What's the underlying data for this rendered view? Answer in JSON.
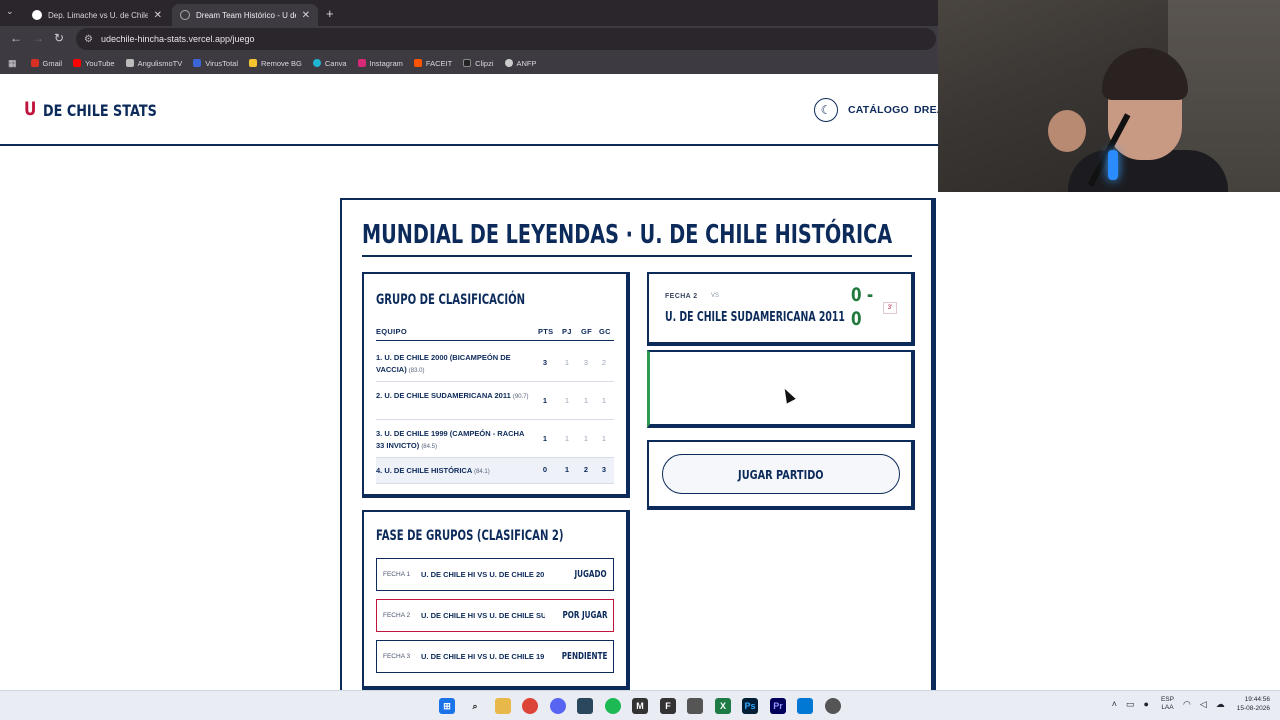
{
  "browser": {
    "tabs": [
      {
        "title": "Dep. Limache vs U. de Chile • I",
        "active": false
      },
      {
        "title": "Dream Team Histórico - U de C",
        "active": true
      }
    ],
    "url": "udechile-hincha-stats.vercel.app/juego",
    "bookmarks": [
      "Gmail",
      "YouTube",
      "AngulismoTV",
      "VirusTotal",
      "Remove BG",
      "Canva",
      "Instagram",
      "FACEIT",
      "Clipzi",
      "ANFP"
    ]
  },
  "site": {
    "logo_mark": "U",
    "logo_text": "DE CHILE STATS",
    "nav": [
      "CATÁLOGO",
      "DREA"
    ]
  },
  "main": {
    "title": "MUNDIAL DE LEYENDAS · U. DE CHILE HISTÓRICA",
    "standings": {
      "title": "GRUPO DE CLASIFICACIÓN",
      "headers": [
        "EQUIPO",
        "PTS",
        "PJ",
        "GF",
        "GC"
      ],
      "rows": [
        {
          "team": "1. U. DE CHILE 2000 (BICAMPEÓN DE VACCIA)",
          "rating": "(83.0)",
          "pts": "3",
          "pj": "1",
          "gf": "3",
          "gc": "2"
        },
        {
          "team": "2. U. DE CHILE SUDAMERICANA 2011",
          "rating": "(90.7)",
          "pts": "1",
          "pj": "1",
          "gf": "1",
          "gc": "1"
        },
        {
          "team": "3. U. DE CHILE 1999 (CAMPEÓN - RACHA 33 INVICTO)",
          "rating": "(84.5)",
          "pts": "1",
          "pj": "1",
          "gf": "1",
          "gc": "1"
        },
        {
          "team": "4. U. DE CHILE HISTÓRICA",
          "rating": "(84.1)",
          "pts": "0",
          "pj": "1",
          "gf": "2",
          "gc": "3"
        }
      ]
    },
    "match": {
      "fecha": "FECHA 2",
      "vs": "VS",
      "opponent": "U. DE CHILE SUDAMERICANA 2011",
      "score_home": "0 -",
      "score_away": "0",
      "minute": "3'"
    },
    "play_button": "JUGAR PARTIDO",
    "fixtures": {
      "title": "FASE DE GRUPOS (CLASIFICAN 2)",
      "items": [
        {
          "fecha": "FECHA 1",
          "match": "U. DE CHILE HI VS U. DE CHILE 20",
          "status": "JUGADO"
        },
        {
          "fecha": "FECHA 2",
          "match": "U. DE CHILE HI VS U. DE CHILE SU",
          "status": "POR JUGAR"
        },
        {
          "fecha": "FECHA 3",
          "match": "U. DE CHILE HI VS U. DE CHILE 19",
          "status": "PENDIENTE"
        }
      ]
    }
  },
  "taskbar": {
    "lang_top": "ESP",
    "lang_bottom": "LAA",
    "time": "19:44:56",
    "date": "15-08-2026"
  },
  "colors": {
    "navy": "#0c2a5a",
    "red": "#c0143c",
    "green": "#1f7a3c"
  }
}
